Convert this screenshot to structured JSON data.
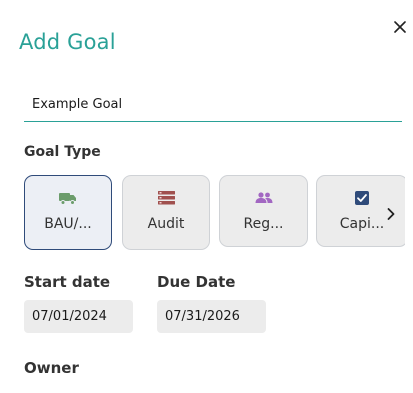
{
  "dialog": {
    "title": "Add Goal",
    "close_icon": "close-icon"
  },
  "goal_name": {
    "value": "Example Goal"
  },
  "goal_type": {
    "label": "Goal Type",
    "options": [
      {
        "label": "BAU/...",
        "icon": "truck-icon",
        "color": "#6b9c6b",
        "selected": true
      },
      {
        "label": "Audit",
        "icon": "list-icon",
        "color": "#a0504e",
        "selected": false
      },
      {
        "label": "Reg...",
        "icon": "people-icon",
        "color": "#a267c2",
        "selected": false
      },
      {
        "label": "Capi...",
        "icon": "checkbox-icon",
        "color": "#2f4b7a",
        "selected": false
      }
    ],
    "next_icon": "chevron-right-icon"
  },
  "start_date": {
    "label": "Start date",
    "value": "07/01/2024"
  },
  "due_date": {
    "label": "Due Date",
    "value": "07/31/2026"
  },
  "owner": {
    "label": "Owner"
  },
  "colors": {
    "accent": "#2aa197",
    "selected_border": "#2f4b7a"
  }
}
